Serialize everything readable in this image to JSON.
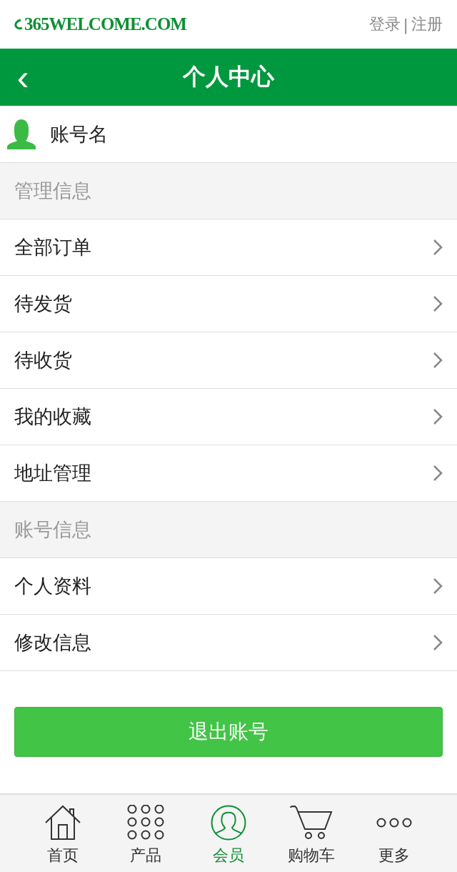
{
  "header": {
    "logo": "365WELCOME.COM",
    "login": "登录",
    "separator": "|",
    "register": "注册"
  },
  "title_bar": {
    "back": "‹",
    "title": "个人中心"
  },
  "account": {
    "name": "账号名"
  },
  "sections": [
    {
      "title": "管理信息",
      "items": [
        "全部订单",
        "待发货",
        "待收货",
        "我的收藏",
        "地址管理"
      ]
    },
    {
      "title": "账号信息",
      "items": [
        "个人资料",
        "修改信息"
      ]
    }
  ],
  "logout_button": "退出账号",
  "tab_bar": [
    {
      "kind": "home",
      "label": "首页",
      "selected": false
    },
    {
      "kind": "grid",
      "label": "产品",
      "selected": false
    },
    {
      "kind": "member",
      "label": "会员",
      "selected": true
    },
    {
      "kind": "cart",
      "label": "购物车",
      "selected": false
    },
    {
      "kind": "more",
      "label": "更多",
      "selected": false
    }
  ]
}
